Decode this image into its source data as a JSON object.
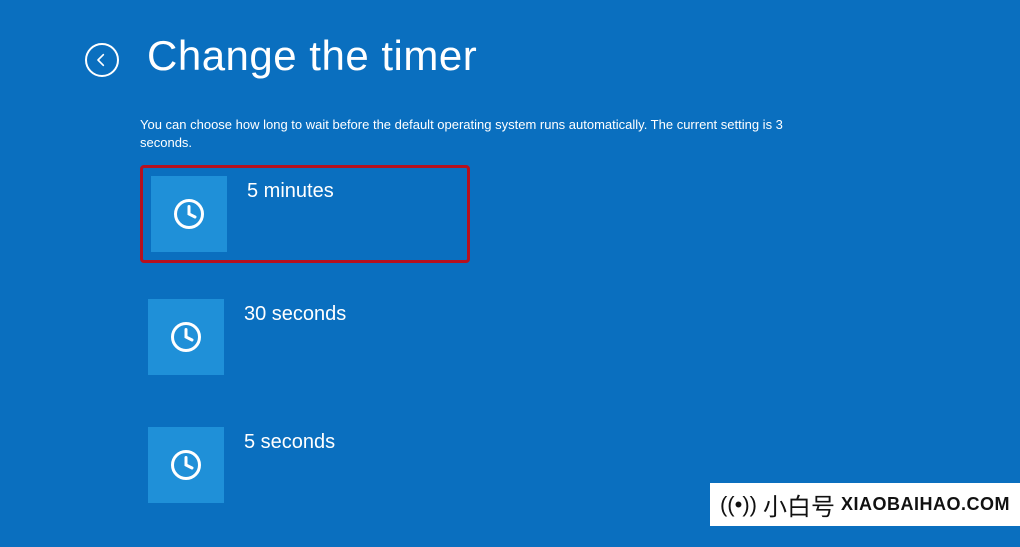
{
  "header": {
    "title": "Change the timer"
  },
  "description": "You can choose how long to wait before the default operating system runs automatically. The current setting is 3 seconds.",
  "options": [
    {
      "label": "5 minutes",
      "highlighted": true
    },
    {
      "label": "30 seconds",
      "highlighted": false
    },
    {
      "label": "5 seconds",
      "highlighted": false
    }
  ],
  "brand": {
    "cn": "小白号",
    "en": "XIAOBAIHAO.COM"
  }
}
